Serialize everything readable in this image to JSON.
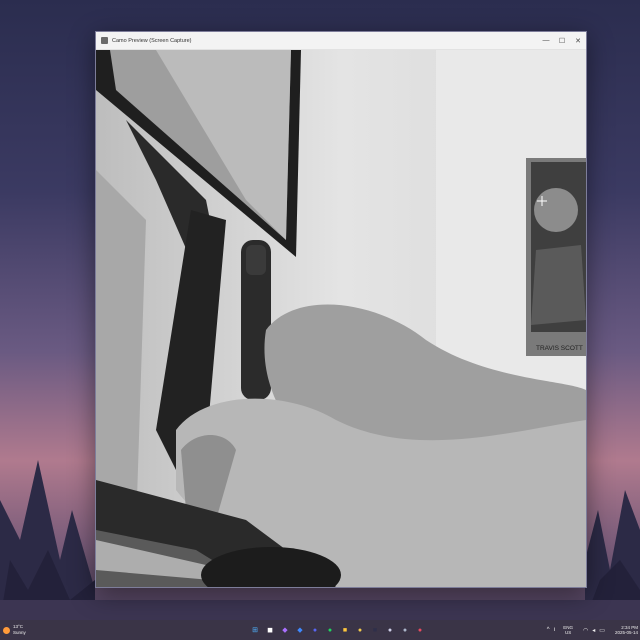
{
  "window": {
    "title": "Camo Preview (Screen Capture)",
    "minimize_glyph": "—",
    "maximize_glyph": "☐",
    "close_glyph": "✕"
  },
  "poster": {
    "text": "TRAVIS SCOTT"
  },
  "weather": {
    "temperature": "13°C",
    "condition": "Sunny"
  },
  "tray": {
    "language_top": "ENG",
    "language_bottom": "US",
    "time": "2:34 PM",
    "date": "2025-05-14",
    "chevron_glyph": "^"
  },
  "taskbar_icons": [
    {
      "name": "start",
      "glyph": "⊞",
      "color": "#4fb3ff"
    },
    {
      "name": "search",
      "glyph": "◼",
      "color": "#ffffff"
    },
    {
      "name": "visual-studio",
      "glyph": "◆",
      "color": "#a970ff"
    },
    {
      "name": "app",
      "glyph": "◆",
      "color": "#3e89ff"
    },
    {
      "name": "discord",
      "glyph": "●",
      "color": "#5865f2"
    },
    {
      "name": "spotify",
      "glyph": "●",
      "color": "#1ed760"
    },
    {
      "name": "file-explorer",
      "glyph": "■",
      "color": "#ffc83d"
    },
    {
      "name": "chrome",
      "glyph": "●",
      "color": "#f2c94c"
    },
    {
      "name": "app-dark",
      "glyph": "■",
      "color": "#2f2f4a"
    },
    {
      "name": "obs",
      "glyph": "●",
      "color": "#cfcfe8"
    },
    {
      "name": "steam",
      "glyph": "●",
      "color": "#aab4c8"
    },
    {
      "name": "camo",
      "glyph": "●",
      "color": "#e84a5f"
    }
  ]
}
